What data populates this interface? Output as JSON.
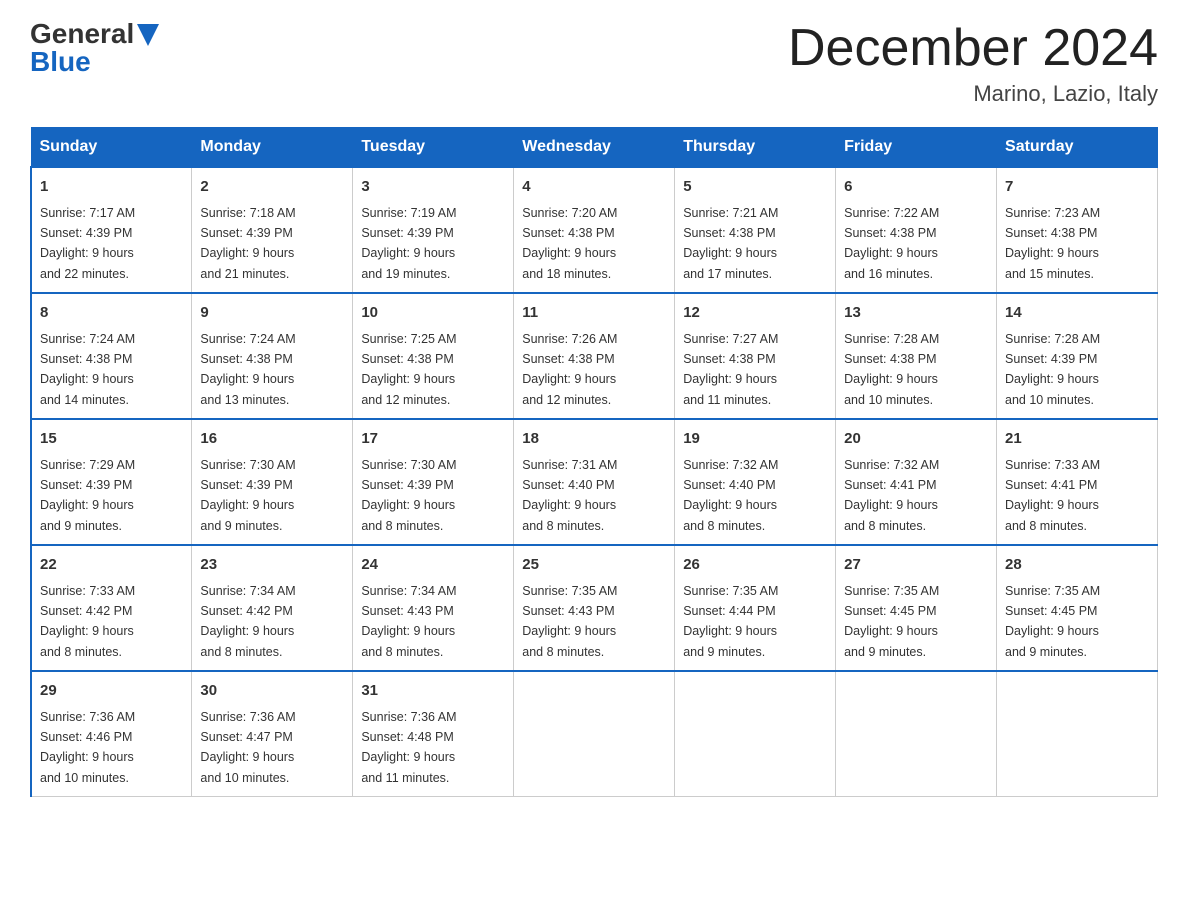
{
  "logo": {
    "general": "General",
    "blue": "Blue"
  },
  "title": "December 2024",
  "location": "Marino, Lazio, Italy",
  "days_of_week": [
    "Sunday",
    "Monday",
    "Tuesday",
    "Wednesday",
    "Thursday",
    "Friday",
    "Saturday"
  ],
  "weeks": [
    [
      {
        "day": "1",
        "sunrise": "7:17 AM",
        "sunset": "4:39 PM",
        "daylight": "9 hours and 22 minutes."
      },
      {
        "day": "2",
        "sunrise": "7:18 AM",
        "sunset": "4:39 PM",
        "daylight": "9 hours and 21 minutes."
      },
      {
        "day": "3",
        "sunrise": "7:19 AM",
        "sunset": "4:39 PM",
        "daylight": "9 hours and 19 minutes."
      },
      {
        "day": "4",
        "sunrise": "7:20 AM",
        "sunset": "4:38 PM",
        "daylight": "9 hours and 18 minutes."
      },
      {
        "day": "5",
        "sunrise": "7:21 AM",
        "sunset": "4:38 PM",
        "daylight": "9 hours and 17 minutes."
      },
      {
        "day": "6",
        "sunrise": "7:22 AM",
        "sunset": "4:38 PM",
        "daylight": "9 hours and 16 minutes."
      },
      {
        "day": "7",
        "sunrise": "7:23 AM",
        "sunset": "4:38 PM",
        "daylight": "9 hours and 15 minutes."
      }
    ],
    [
      {
        "day": "8",
        "sunrise": "7:24 AM",
        "sunset": "4:38 PM",
        "daylight": "9 hours and 14 minutes."
      },
      {
        "day": "9",
        "sunrise": "7:24 AM",
        "sunset": "4:38 PM",
        "daylight": "9 hours and 13 minutes."
      },
      {
        "day": "10",
        "sunrise": "7:25 AM",
        "sunset": "4:38 PM",
        "daylight": "9 hours and 12 minutes."
      },
      {
        "day": "11",
        "sunrise": "7:26 AM",
        "sunset": "4:38 PM",
        "daylight": "9 hours and 12 minutes."
      },
      {
        "day": "12",
        "sunrise": "7:27 AM",
        "sunset": "4:38 PM",
        "daylight": "9 hours and 11 minutes."
      },
      {
        "day": "13",
        "sunrise": "7:28 AM",
        "sunset": "4:38 PM",
        "daylight": "9 hours and 10 minutes."
      },
      {
        "day": "14",
        "sunrise": "7:28 AM",
        "sunset": "4:39 PM",
        "daylight": "9 hours and 10 minutes."
      }
    ],
    [
      {
        "day": "15",
        "sunrise": "7:29 AM",
        "sunset": "4:39 PM",
        "daylight": "9 hours and 9 minutes."
      },
      {
        "day": "16",
        "sunrise": "7:30 AM",
        "sunset": "4:39 PM",
        "daylight": "9 hours and 9 minutes."
      },
      {
        "day": "17",
        "sunrise": "7:30 AM",
        "sunset": "4:39 PM",
        "daylight": "9 hours and 8 minutes."
      },
      {
        "day": "18",
        "sunrise": "7:31 AM",
        "sunset": "4:40 PM",
        "daylight": "9 hours and 8 minutes."
      },
      {
        "day": "19",
        "sunrise": "7:32 AM",
        "sunset": "4:40 PM",
        "daylight": "9 hours and 8 minutes."
      },
      {
        "day": "20",
        "sunrise": "7:32 AM",
        "sunset": "4:41 PM",
        "daylight": "9 hours and 8 minutes."
      },
      {
        "day": "21",
        "sunrise": "7:33 AM",
        "sunset": "4:41 PM",
        "daylight": "9 hours and 8 minutes."
      }
    ],
    [
      {
        "day": "22",
        "sunrise": "7:33 AM",
        "sunset": "4:42 PM",
        "daylight": "9 hours and 8 minutes."
      },
      {
        "day": "23",
        "sunrise": "7:34 AM",
        "sunset": "4:42 PM",
        "daylight": "9 hours and 8 minutes."
      },
      {
        "day": "24",
        "sunrise": "7:34 AM",
        "sunset": "4:43 PM",
        "daylight": "9 hours and 8 minutes."
      },
      {
        "day": "25",
        "sunrise": "7:35 AM",
        "sunset": "4:43 PM",
        "daylight": "9 hours and 8 minutes."
      },
      {
        "day": "26",
        "sunrise": "7:35 AM",
        "sunset": "4:44 PM",
        "daylight": "9 hours and 9 minutes."
      },
      {
        "day": "27",
        "sunrise": "7:35 AM",
        "sunset": "4:45 PM",
        "daylight": "9 hours and 9 minutes."
      },
      {
        "day": "28",
        "sunrise": "7:35 AM",
        "sunset": "4:45 PM",
        "daylight": "9 hours and 9 minutes."
      }
    ],
    [
      {
        "day": "29",
        "sunrise": "7:36 AM",
        "sunset": "4:46 PM",
        "daylight": "9 hours and 10 minutes."
      },
      {
        "day": "30",
        "sunrise": "7:36 AM",
        "sunset": "4:47 PM",
        "daylight": "9 hours and 10 minutes."
      },
      {
        "day": "31",
        "sunrise": "7:36 AM",
        "sunset": "4:48 PM",
        "daylight": "9 hours and 11 minutes."
      },
      null,
      null,
      null,
      null
    ]
  ]
}
